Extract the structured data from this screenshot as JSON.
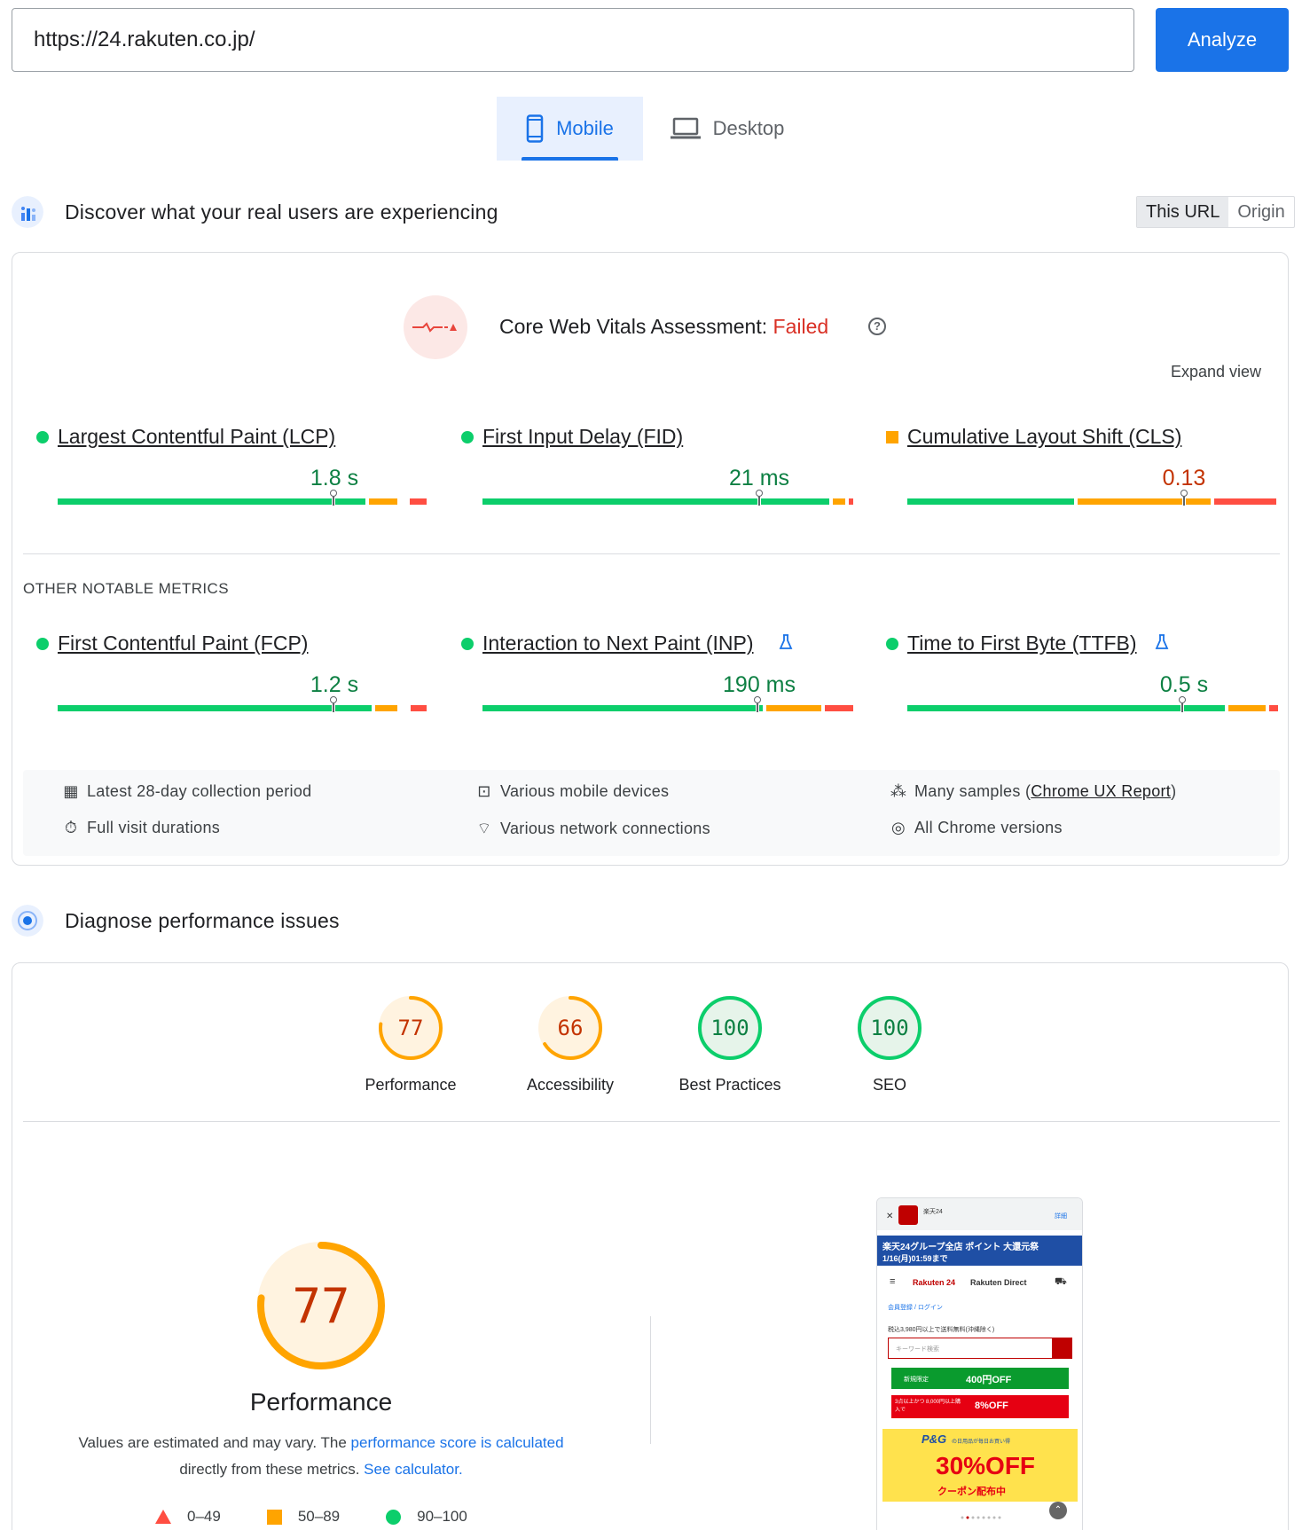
{
  "url_bar": {
    "value": "https://24.rakuten.co.jp/",
    "button": "Analyze"
  },
  "device_tabs": [
    {
      "label": "Mobile",
      "icon": "smartphone-icon",
      "selected": true
    },
    {
      "label": "Desktop",
      "icon": "laptop-icon",
      "selected": false
    }
  ],
  "field_section": {
    "title": "Discover what your real users are experiencing",
    "scope_toggle": {
      "this_url": "This URL",
      "origin": "Origin",
      "selected": "This URL"
    },
    "assessment": {
      "label": "Core Web Vitals Assessment: ",
      "status": "Failed"
    },
    "expand_view": "Expand view",
    "core_metrics": [
      {
        "name": "Largest Contentful Paint (LCP)",
        "value": "1.8 s",
        "rating": "good"
      },
      {
        "name": "First Input Delay (FID)",
        "value": "21 ms",
        "rating": "good"
      },
      {
        "name": "Cumulative Layout Shift (CLS)",
        "value": "0.13",
        "rating": "needs-improvement"
      }
    ],
    "other_label": "OTHER NOTABLE METRICS",
    "other_metrics": [
      {
        "name": "First Contentful Paint (FCP)",
        "value": "1.2 s",
        "rating": "good",
        "experimental": false
      },
      {
        "name": "Interaction to Next Paint (INP)",
        "value": "190 ms",
        "rating": "good",
        "experimental": true
      },
      {
        "name": "Time to First Byte (TTFB)",
        "value": "0.5 s",
        "rating": "good",
        "experimental": true
      }
    ],
    "info": {
      "period": "Latest 28-day collection period",
      "durations": "Full visit durations",
      "devices": "Various mobile devices",
      "network": "Various network connections",
      "samples_prefix": "Many samples (",
      "samples_link": "Chrome UX Report",
      "samples_suffix": ")",
      "versions": "All Chrome versions"
    }
  },
  "lab_section": {
    "title": "Diagnose performance issues",
    "scores": [
      {
        "label": "Performance",
        "score": 77,
        "display": "77",
        "rating": "average"
      },
      {
        "label": "Accessibility",
        "score": 66,
        "display": "66",
        "rating": "average"
      },
      {
        "label": "Best Practices",
        "score": 100,
        "display": "100",
        "rating": "pass"
      },
      {
        "label": "SEO",
        "score": 100,
        "display": "100",
        "rating": "pass"
      }
    ],
    "main_score": {
      "display": "77",
      "score": 77,
      "title": "Performance"
    },
    "description": {
      "text1": "Values are estimated and may vary. The ",
      "link1": "performance score is calculated",
      "text2": "directly from these metrics. ",
      "link2": "See calculator."
    },
    "legend": {
      "fail": "0–49",
      "average": "50–89",
      "pass": "90–100"
    },
    "screenshot": {
      "store": "楽天24",
      "details": "詳細",
      "banner": "楽天24グループ全店 ポイント 大還元祭",
      "banner_date": "1/16(月)01:59まで",
      "brand": "Rakuten 24",
      "brand2": "Rakuten Direct",
      "login": "会員登録 / ログイン",
      "shipping": "税込3,980円以上で送料無料(沖縄除く)",
      "search_placeholder": "キーワード検索",
      "coupon1_tag": "新規限定",
      "coupon1_value": "400円OFF",
      "coupon2_tag": "3点以上かつ 8,000円以上購入で",
      "coupon2_value": "8%OFF",
      "promo_brand": "P&G",
      "promo_text": "の日用品が毎日お買い得",
      "promo_value": "30%OFF",
      "promo_sub": "クーポン配布中"
    }
  },
  "colors": {
    "accent": "#1a73e8",
    "pass": "#0cce6b",
    "average": "#ffa400",
    "fail": "#ff4e42",
    "fail_text": "#d93025"
  }
}
